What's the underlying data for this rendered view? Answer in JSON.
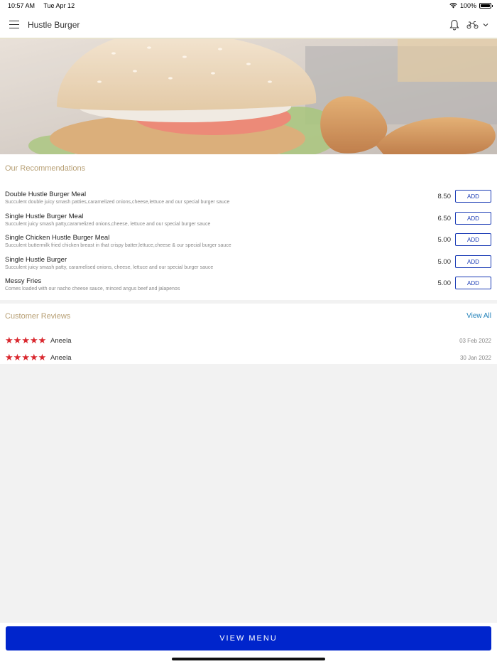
{
  "status_bar": {
    "time": "10:57 AM",
    "date": "Tue Apr 12",
    "battery": "100%"
  },
  "header": {
    "title": "Hustle Burger",
    "icons": [
      "menu-icon",
      "bell-icon",
      "delivery-scooter-icon",
      "chevron-down-icon"
    ]
  },
  "recommendations": {
    "title": "Our Recommendations",
    "add_label": "ADD",
    "items": [
      {
        "name": "Double Hustle Burger Meal",
        "description": "Succulent double juicy smash patties,caramelized onions,cheese,lettuce and our special burger sauce",
        "price": "8.50"
      },
      {
        "name": "Single Hustle Burger Meal",
        "description": "Succulent juicy smash patty,caramelized onions,cheese, lettuce and our special burger sauce",
        "price": "6.50"
      },
      {
        "name": "Single Chicken Hustle Burger Meal",
        "description": "Succulent buttermilk fried chicken breast in that crispy batter,lettuce,cheese & our special burger sauce",
        "price": "5.00"
      },
      {
        "name": "Single Hustle Burger",
        "description": "Succulent juicy smash patty, caramelised onions, cheese, lettuce and our special burger sauce",
        "price": "5.00"
      },
      {
        "name": "Messy Fries",
        "description": "Comes loaded with our nacho cheese sauce, minced angus beef and jalapenos",
        "price": "5.00"
      }
    ]
  },
  "reviews": {
    "title": "Customer Reviews",
    "view_all": "View All",
    "items": [
      {
        "name": "Aneela",
        "rating": 5,
        "date": "03 Feb 2022"
      },
      {
        "name": "Aneela",
        "rating": 5,
        "date": "30 Jan 2022"
      }
    ]
  },
  "footer": {
    "view_menu_label": "VIEW MENU"
  },
  "colors": {
    "accent": "#0025cc",
    "section_title": "#b79f74",
    "star": "#d9272e",
    "link": "#1e7fb8"
  }
}
